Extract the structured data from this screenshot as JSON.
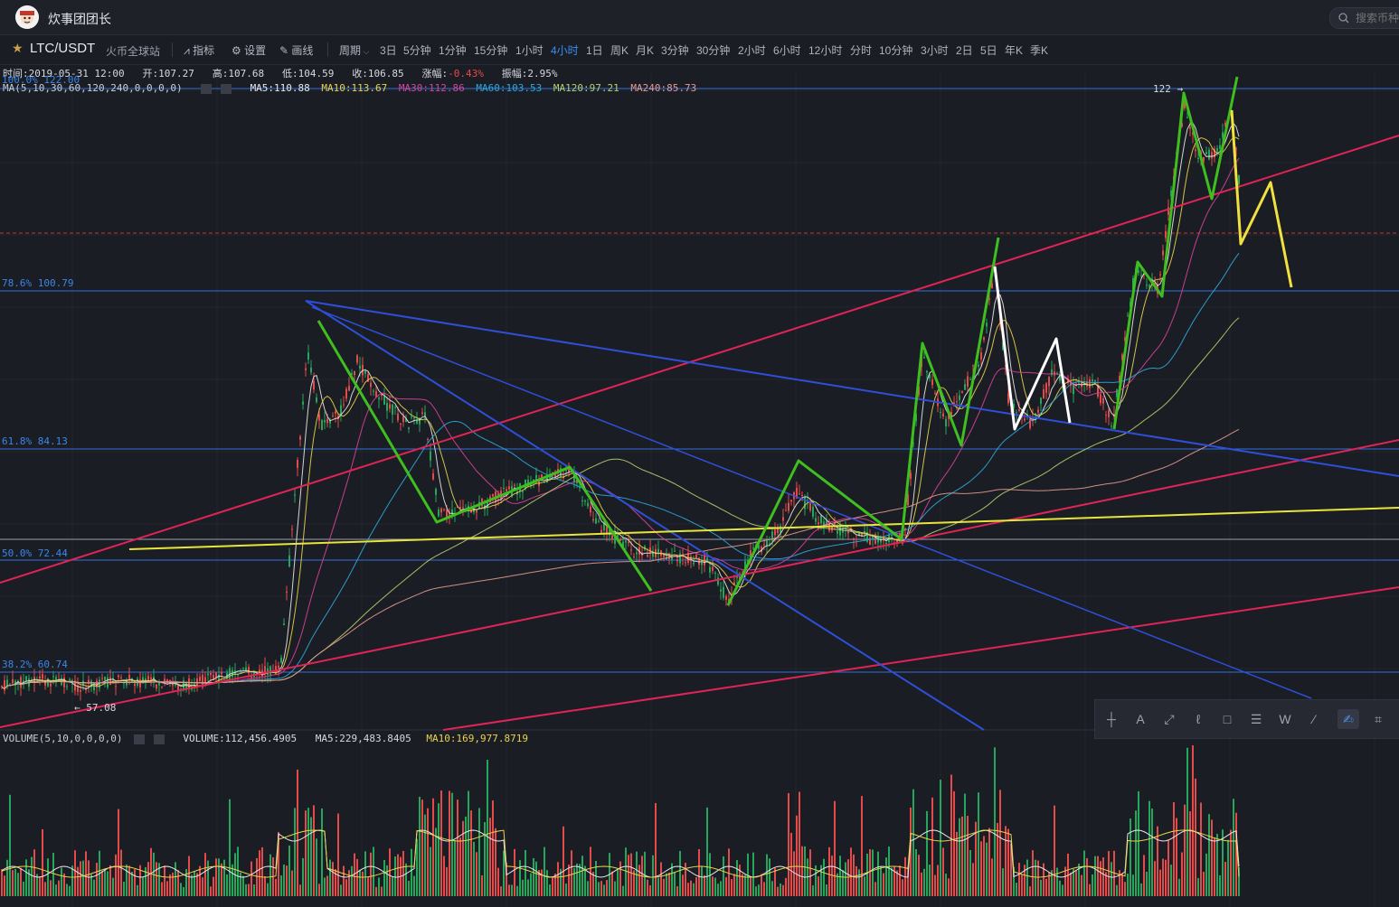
{
  "app": {
    "title": "炊事团团长"
  },
  "search": {
    "placeholder": "搜索币种"
  },
  "toolbar": {
    "pair": "LTC/USDT",
    "exchange": "火币全球站",
    "indicators": "指标",
    "settings": "设置",
    "draw": "画线",
    "period_label": "周期",
    "periods": [
      "3日",
      "5分钟",
      "1分钟",
      "15分钟",
      "1小时",
      "4小时",
      "1日",
      "周K",
      "月K",
      "3分钟",
      "30分钟",
      "2小时",
      "6小时",
      "12小时",
      "分时",
      "10分钟",
      "3小时",
      "2日",
      "5日",
      "年K",
      "季K"
    ],
    "active_period": "4小时"
  },
  "info": {
    "time_label": "时间:",
    "time": "2019-05-31 12:00",
    "open_label": "开:",
    "open": "107.27",
    "high_label": "高:",
    "high": "107.68",
    "low_label": "低:",
    "low": "104.59",
    "close_label": "收:",
    "close": "106.85",
    "change_label": "涨幅:",
    "change": "-0.43%",
    "amplitude_label": "振幅:",
    "amplitude": "2.95%"
  },
  "ma": {
    "label": "MA(5,10,30,60,120,240,0,0,0,0)",
    "ma5": "MA5:110.88",
    "ma10": "MA10:113.67",
    "ma30": "MA30:112.86",
    "ma60": "MA60:103.53",
    "ma120": "MA120:97.21",
    "ma240": "MA240:85.73",
    "colors": {
      "ma5": "#e8e8e8",
      "ma10": "#e8d44d",
      "ma30": "#d9439b",
      "ma60": "#2ea8e0",
      "ma120": "#b5d26a",
      "ma240": "#e59a8f"
    }
  },
  "fib": {
    "l100": "100.0% 122.00",
    "l786": "78.6% 100.79",
    "l618": "61.8% 84.13",
    "l500": "50.0% 72.44",
    "l382": "38.2% 60.74"
  },
  "price_markers": {
    "high": "122",
    "low": "57.08"
  },
  "volume": {
    "label": "VOLUME(5,10,0,0,0,0)",
    "value": "VOLUME:112,456.4905",
    "ma5": "MA5:229,483.8405",
    "ma10": "MA10:169,977.8719"
  },
  "drawing_tools": [
    "crosshair-icon",
    "text-icon",
    "ray-icon",
    "fib-icon",
    "rect-icon",
    "parallel-icon",
    "wave-icon",
    "ruler-icon",
    "brush-icon",
    "grid-icon"
  ],
  "colors": {
    "up": "#26a65b",
    "down": "#e34a4a",
    "accent": "#3b8ef0",
    "fib": "#2f6fd8"
  }
}
